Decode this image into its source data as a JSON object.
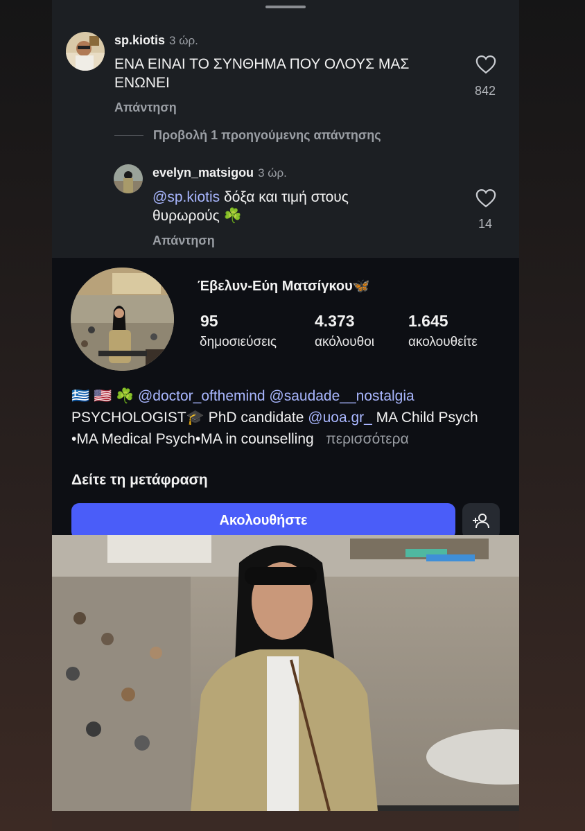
{
  "comment1": {
    "username": "sp.kiotis",
    "time": "3 ώρ.",
    "text": "ΕΝΑ ΕΙΝΑΙ ΤΟ ΣΥΝΘΗΜΑ ΠΟΥ ΟΛΟΥΣ ΜΑΣ ΕΝΩΝΕΙ",
    "likes": "842",
    "reply_label": "Απάντηση"
  },
  "view_previous": "Προβολή 1 προηγούμενης απάντησης",
  "comment2": {
    "username": "evelyn_matsigou",
    "time": "3 ώρ.",
    "mention": "@sp.kiotis",
    "text": " δόξα και τιμή στους θυρωρούς ☘️",
    "likes": "14",
    "reply_label": "Απάντηση"
  },
  "profile": {
    "name": "Έβελυν-Εύη Ματσίγκου🦋",
    "stats": [
      {
        "value": "95",
        "label": "δημοσιεύσεις"
      },
      {
        "value": "4.373",
        "label": "ακόλουθοι"
      },
      {
        "value": "1.645",
        "label": "ακολουθείτε"
      }
    ],
    "bio_flags": "🇬🇷 🇺🇸 ☘️",
    "bio_mentions": "@doctor_ofthemind @saudade__nostalgia",
    "bio_line2_a": "PSYCHOLOGIST🎓 PhD candidate ",
    "bio_line2_mention": "@uoa.gr_",
    "bio_line2_b": " MA Child Psych",
    "bio_line3": "•MA Medical Psych•MA in counselling",
    "more_label": "περισσότερα",
    "translate_label": "Δείτε τη μετάφραση",
    "follow_label": "Ακολουθήστε"
  },
  "colors": {
    "accent": "#4a5df9",
    "mention": "#a9b7ff",
    "sheet_bg": "#1c1f23",
    "profile_bg": "#0d0f14"
  },
  "icons": [
    "heart-icon",
    "add-user-icon",
    "drag-handle"
  ]
}
